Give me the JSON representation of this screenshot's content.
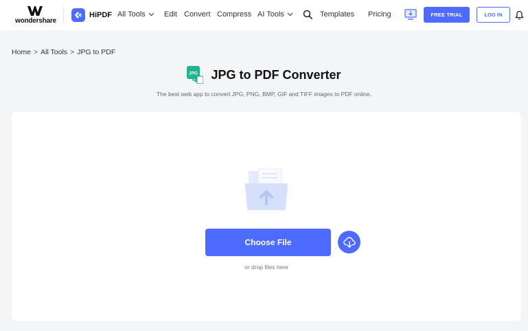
{
  "header": {
    "brand": "wondershare",
    "product": "HiPDF",
    "nav": [
      {
        "label": "All Tools",
        "dropdown": true
      },
      {
        "label": "Edit",
        "dropdown": false
      },
      {
        "label": "Convert",
        "dropdown": false
      },
      {
        "label": "Compress",
        "dropdown": false
      },
      {
        "label": "AI Tools",
        "dropdown": true
      },
      {
        "label": "Templates",
        "dropdown": false
      },
      {
        "label": "Pricing",
        "dropdown": false
      }
    ],
    "free_trial_label": "FREE TRIAL",
    "login_label": "LOG IN",
    "icons": [
      "search-icon",
      "desktop-download-icon",
      "bell-icon"
    ]
  },
  "breadcrumb": [
    "Home",
    "All Tools",
    "JPG to PDF"
  ],
  "breadcrumb_separator": ">",
  "main": {
    "icon_label": "JPG",
    "title": "JPG to PDF Converter",
    "subtitle": "The best web app to convert JPG, PNG, BMP, GIF and TIFF images to PDF online.",
    "choose_file_label": "Choose File",
    "drop_hint": "or drop files here"
  },
  "colors": {
    "accent": "#4d6bff",
    "page_bg": "#f4f5f7",
    "card_bg": "#ffffff",
    "jpg_icon": "#24b38a"
  }
}
